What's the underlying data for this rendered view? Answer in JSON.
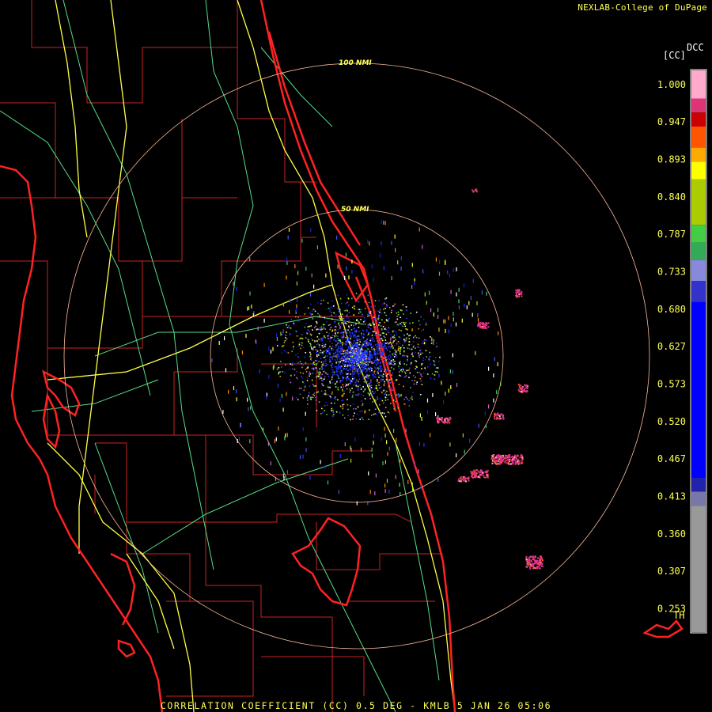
{
  "header": {
    "credit": "NEXLAB-College of DuPage"
  },
  "footer": {
    "product_title": "CORRELATION COEFFICIENT (CC) 0.5 DEG - KMLB 5 JAN 26 05:06"
  },
  "range_rings": [
    {
      "label": "100 NMI",
      "range_nmi": 100
    },
    {
      "label": "50 NMI",
      "range_nmi": 50
    }
  ],
  "colorbar": {
    "unit": "[CC]",
    "title": "DCC",
    "ticks": [
      "1.000",
      "0.947",
      "0.893",
      "0.840",
      "0.787",
      "0.733",
      "0.680",
      "0.627",
      "0.573",
      "0.520",
      "0.467",
      "0.413",
      "0.360",
      "0.307",
      "0.253"
    ],
    "threshold_label": "TH",
    "stops": [
      {
        "value": 1.02,
        "color": "#ffaacc"
      },
      {
        "value": 0.98,
        "color": "#dd3377"
      },
      {
        "value": 0.96,
        "color": "#cc0000"
      },
      {
        "value": 0.94,
        "color": "#ff5500"
      },
      {
        "value": 0.91,
        "color": "#ffaa00"
      },
      {
        "value": 0.89,
        "color": "#ffff00"
      },
      {
        "value": 0.865,
        "color": "#aacc00"
      },
      {
        "value": 0.8,
        "color": "#44cc44"
      },
      {
        "value": 0.775,
        "color": "#33aa55"
      },
      {
        "value": 0.75,
        "color": "#8888dd"
      },
      {
        "value": 0.72,
        "color": "#3333cc"
      },
      {
        "value": 0.69,
        "color": "#0000ff"
      },
      {
        "value": 0.44,
        "color": "#2222aa"
      },
      {
        "value": 0.42,
        "color": "#7777aa"
      },
      {
        "value": 0.4,
        "color": "#999999"
      },
      {
        "value": 0.22,
        "color": "#000000"
      }
    ]
  },
  "colors": {
    "coastline": "#ff2222",
    "county_lines": "#cc2222",
    "highways": "#ffff44",
    "roads": "#55dd88",
    "range_rings": "#ffbb99"
  }
}
